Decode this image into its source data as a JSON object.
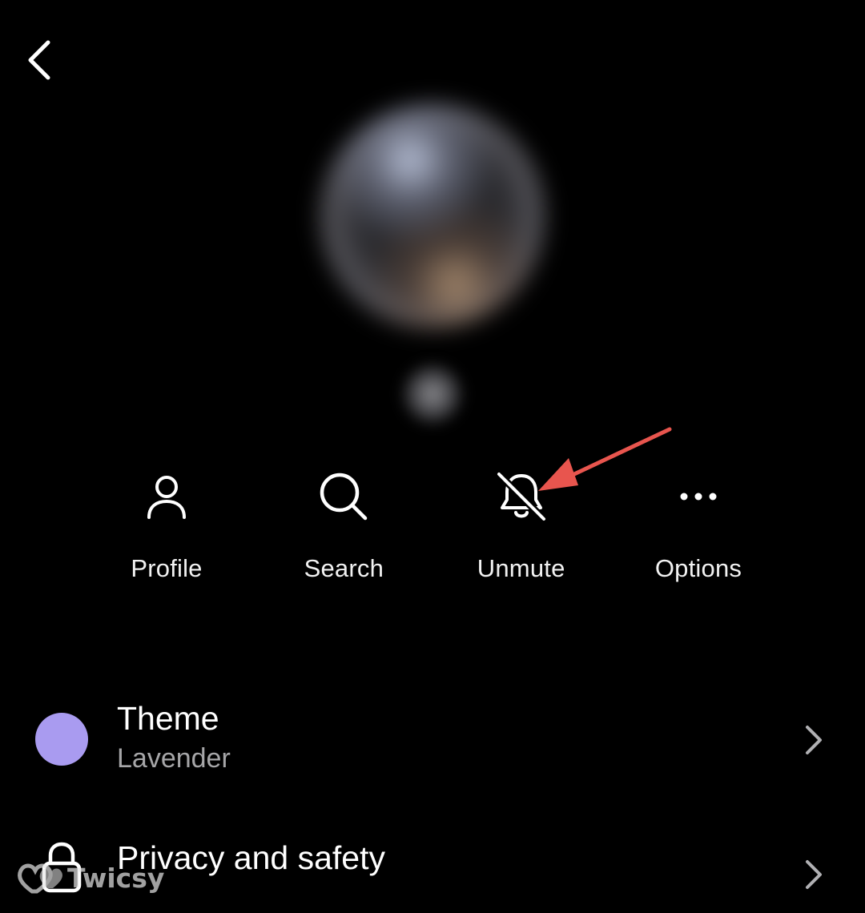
{
  "header": {
    "back_icon": "chevron-left-icon"
  },
  "actions": [
    {
      "label": "Profile",
      "icon": "person-icon"
    },
    {
      "label": "Search",
      "icon": "search-icon"
    },
    {
      "label": "Unmute",
      "icon": "bell-slash-icon"
    },
    {
      "label": "Options",
      "icon": "more-horizontal-icon"
    }
  ],
  "annotation": {
    "arrow_color": "#e8554e"
  },
  "settings": {
    "theme": {
      "title": "Theme",
      "value": "Lavender",
      "swatch_color": "#a99bf0"
    },
    "privacy": {
      "title": "Privacy and safety",
      "icon": "lock-icon"
    }
  },
  "watermark": {
    "text": "Twicsy"
  }
}
